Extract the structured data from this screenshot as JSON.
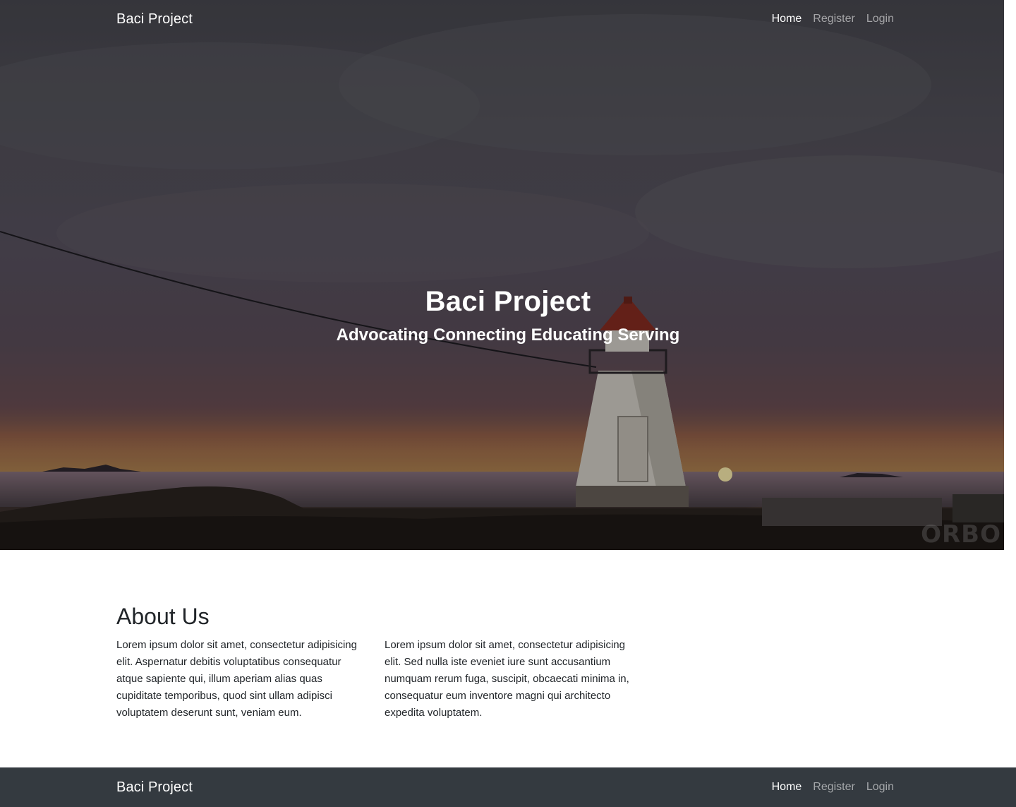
{
  "header": {
    "brand": "Baci Project",
    "nav": [
      {
        "label": "Home",
        "active": true
      },
      {
        "label": "Register",
        "active": false
      },
      {
        "label": "Login",
        "active": false
      }
    ]
  },
  "hero": {
    "title": "Baci Project",
    "subtitle": "Advocating Connecting Educating Serving",
    "watermark": "ORBO"
  },
  "about": {
    "title": "About Us",
    "paragraphs": [
      "Lorem ipsum dolor sit amet, consectetur adipisicing elit. Aspernatur debitis voluptatibus consequatur atque sapiente qui, illum aperiam alias quas cupiditate temporibus, quod sint ullam adipisci voluptatem deserunt sunt, veniam eum.",
      "Lorem ipsum dolor sit amet, consectetur adipisicing elit. Sed nulla iste eveniet iure sunt accusantium numquam rerum fuga, suscipit, obcaecati minima in, consequatur eum inventore magni qui architecto expedita voluptatem."
    ]
  },
  "footer": {
    "brand": "Baci Project",
    "nav": [
      {
        "label": "Home",
        "active": true
      },
      {
        "label": "Register",
        "active": false
      },
      {
        "label": "Login",
        "active": false
      }
    ]
  },
  "colors": {
    "footer_bg": "#343a40",
    "text_dark": "#212529",
    "nav_inactive": "rgba(255,255,255,0.55)"
  }
}
